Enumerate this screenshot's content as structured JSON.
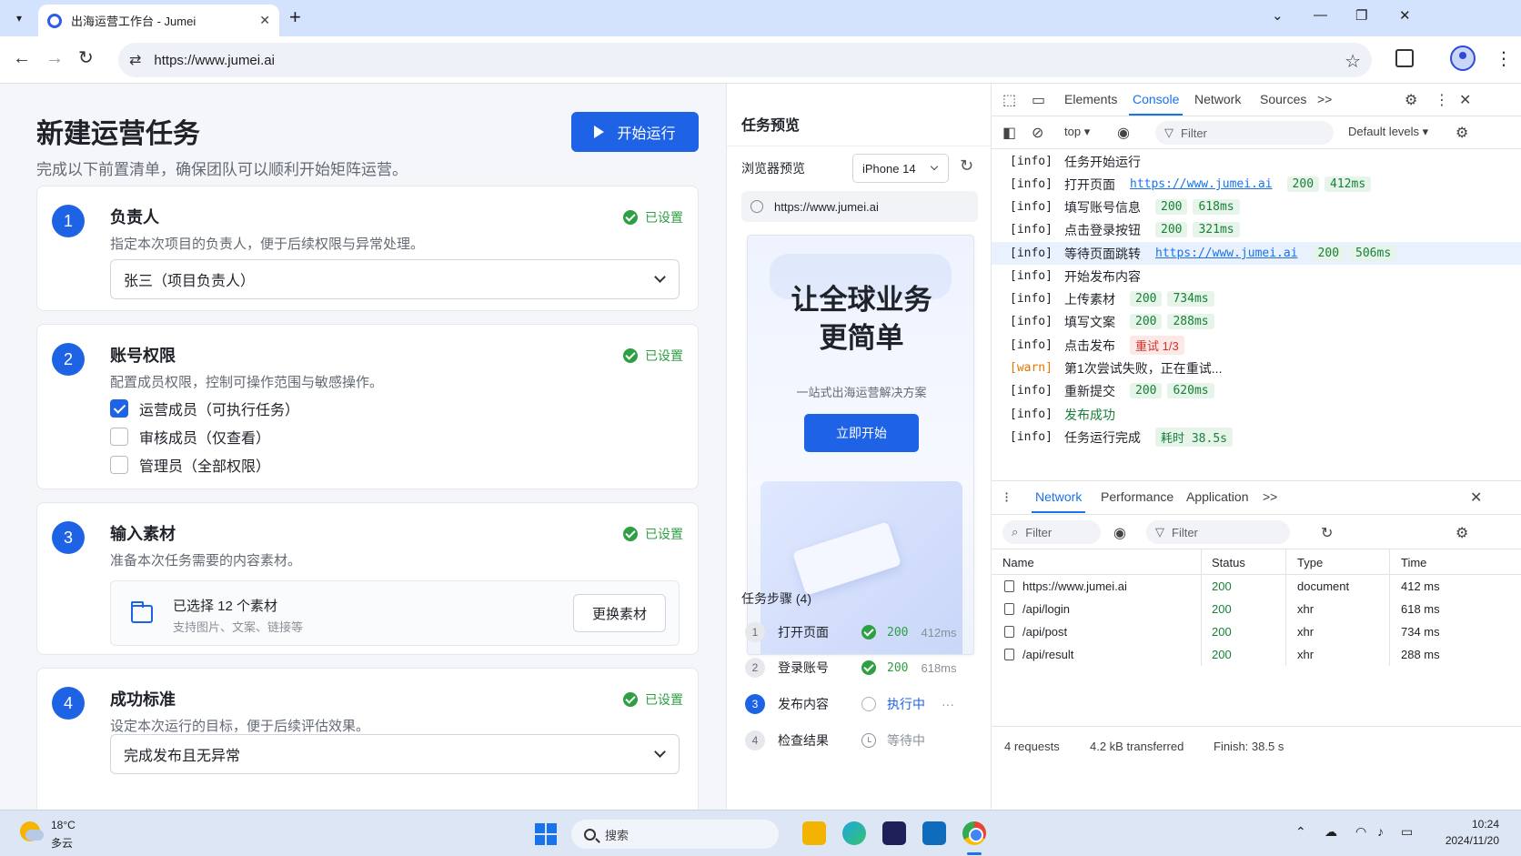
{
  "browser": {
    "tab_title": "出海运营工作台 - Jumei",
    "url": "https://www.jumei.ai"
  },
  "page": {
    "title": "新建运营任务",
    "subtitle": "完成以下前置清单，确保团队可以顺利开始矩阵运营。",
    "run_button": "开始运行",
    "set_badge": "已设置",
    "cards": [
      {
        "num": "1",
        "title": "负责人",
        "desc": "指定本次项目的负责人，便于后续权限与异常处理。",
        "select_value": "张三（项目负责人）"
      },
      {
        "num": "2",
        "title": "账号权限",
        "desc": "配置成员权限，控制可操作范围与敏感操作。",
        "options": [
          {
            "label": "运营成员（可执行任务）",
            "checked": true
          },
          {
            "label": "审核成员（仅查看）",
            "checked": false
          },
          {
            "label": "管理员（全部权限）",
            "checked": false
          }
        ]
      },
      {
        "num": "3",
        "title": "输入素材",
        "desc": "准备本次任务需要的内容素材。",
        "material_title": "已选择 12 个素材",
        "material_sub": "支持图片、文案、链接等",
        "material_button": "更换素材"
      },
      {
        "num": "4",
        "title": "成功标准",
        "desc": "设定本次运行的目标，便于后续评估效果。",
        "select_value": "完成发布且无异常"
      }
    ]
  },
  "preview": {
    "title": "任务预览",
    "browser_label": "浏览器预览",
    "device": "iPhone 14",
    "url": "https://www.jumei.ai",
    "hero_line1": "让全球业务",
    "hero_line2": "更简单",
    "hero_sub": "一站式出海运营解决方案",
    "hero_button": "立即开始",
    "steps_title": "任务步骤 (4)",
    "steps": [
      {
        "num": "1",
        "name": "打开页面",
        "code": "200",
        "time": "412ms",
        "state": "done"
      },
      {
        "num": "2",
        "name": "登录账号",
        "code": "200",
        "time": "618ms",
        "state": "done"
      },
      {
        "num": "3",
        "name": "发布内容",
        "status": "执行中",
        "dots": "···",
        "state": "running"
      },
      {
        "num": "4",
        "name": "检查结果",
        "status": "等待中",
        "state": "waiting"
      }
    ]
  },
  "devtools": {
    "tabs": [
      "Elements",
      "Console",
      "Network",
      "Sources"
    ],
    "more": ">>",
    "context": "top",
    "filter_placeholder": "Filter",
    "levels": "Default levels",
    "console": [
      {
        "level": "[info]",
        "msg": "任务开始运行"
      },
      {
        "level": "[info]",
        "msg": "打开页面",
        "link": "https://www.jumei.ai",
        "code": "200",
        "time": "412ms"
      },
      {
        "level": "[info]",
        "msg": "填写账号信息",
        "code": "200",
        "time": "618ms"
      },
      {
        "level": "[info]",
        "msg": "点击登录按钮",
        "code": "200",
        "time": "321ms"
      },
      {
        "level": "[info]",
        "msg": "等待页面跳转",
        "link": "https://www.jumei.ai",
        "code": "200",
        "time": "506ms"
      },
      {
        "level": "[info]",
        "msg": "开始发布内容"
      },
      {
        "level": "[info]",
        "msg": "上传素材",
        "code": "200",
        "time": "734ms"
      },
      {
        "level": "[info]",
        "msg": "填写文案",
        "code": "200",
        "time": "288ms"
      },
      {
        "level": "[info]",
        "msg": "点击发布",
        "retry": "重试 1/3"
      },
      {
        "level": "[warn]",
        "msg": "第1次尝试失败，正在重试..."
      },
      {
        "level": "[info]",
        "msg": "重新提交",
        "code": "200",
        "time": "620ms"
      },
      {
        "level": "[info]",
        "msg": "发布成功"
      },
      {
        "level": "[info]",
        "msg": "任务运行完成",
        "elapsed_label": "耗时",
        "elapsed": "38.5s"
      }
    ],
    "drawer_tabs": [
      "Network",
      "Performance",
      "Application"
    ],
    "net_filter": "Filter",
    "net_columns": [
      "Name",
      "Status",
      "Type",
      "Time"
    ],
    "net_rows": [
      {
        "name": "https://www.jumei.ai",
        "status": "200",
        "type": "document",
        "time": "412 ms"
      },
      {
        "name": "/api/login",
        "status": "200",
        "type": "xhr",
        "time": "618 ms"
      },
      {
        "name": "/api/post",
        "status": "200",
        "type": "xhr",
        "time": "734 ms"
      },
      {
        "name": "/api/result",
        "status": "200",
        "type": "xhr",
        "time": "288 ms"
      }
    ],
    "summary": {
      "requests": "4 requests",
      "transferred": "4.2 kB transferred",
      "finish": "Finish: 38.5 s"
    }
  },
  "taskbar": {
    "temp": "18°C",
    "weather": "多云",
    "search": "搜索",
    "time": "10:24",
    "date": "2024/11/20"
  },
  "colors": {
    "accent": "#1e62e6",
    "success": "#2ea043",
    "warn": "#e37400",
    "error": "#d93025"
  }
}
